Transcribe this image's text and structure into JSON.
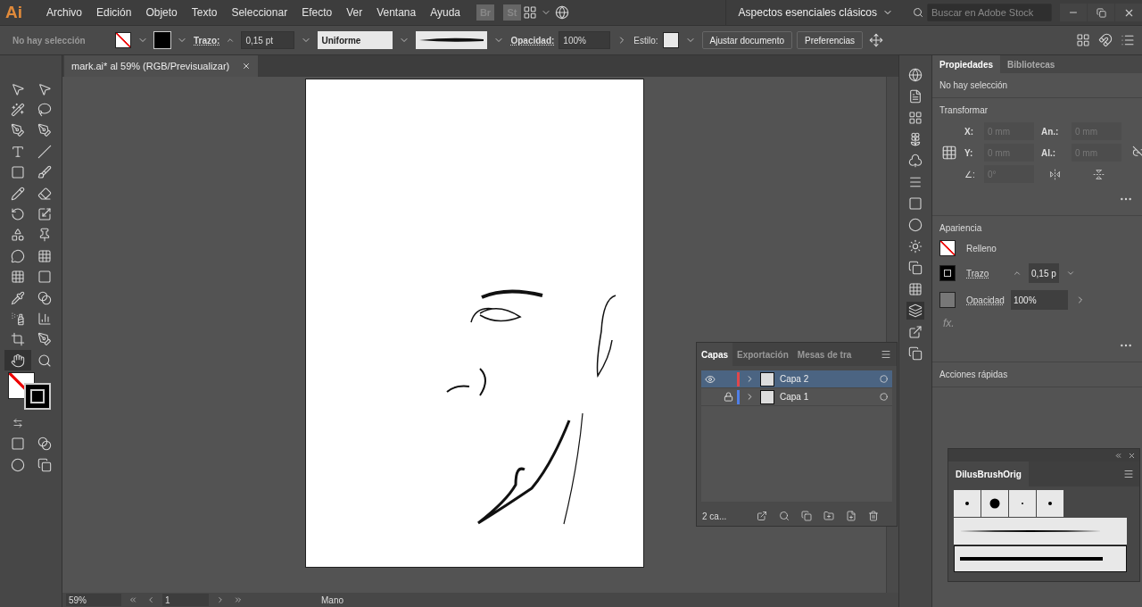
{
  "menu_bar": {
    "logo": "Ai",
    "menus": [
      "Archivo",
      "Edición",
      "Objeto",
      "Texto",
      "Seleccionar",
      "Efecto",
      "Ver",
      "Ventana",
      "Ayuda"
    ],
    "bridge": "Br",
    "stock": "St",
    "workspace": "Aspectos esenciales clásicos",
    "search": {
      "placeholder": "Buscar en Adobe Stock"
    }
  },
  "control_bar": {
    "selection": "No hay selección",
    "stroke_label": "Trazo:",
    "stroke_value": "0,15 pt",
    "profile": "Uniforme",
    "opacity_label": "Opacidad:",
    "opacity_value": "100%",
    "style_label": "Estilo:",
    "buttons": [
      "Ajustar documento",
      "Preferencias"
    ]
  },
  "document": {
    "tab": "mark.ai* al 59% (RGB/Previsualizar)",
    "zoom": "59%",
    "artboard": "1",
    "status": "Mano"
  },
  "layers_panel": {
    "tabs": [
      {
        "label": "Capas",
        "selected": true
      },
      {
        "label": "Exportación",
        "selected": false
      },
      {
        "label": "Mesas de tra",
        "selected": false
      }
    ],
    "layers": [
      {
        "name": "Capa 2",
        "visible": true,
        "locked": false,
        "selected": true,
        "color": "#e0474c"
      },
      {
        "name": "Capa 1",
        "visible": false,
        "locked": true,
        "selected": false,
        "color": "#4f7fe8"
      }
    ],
    "count": "2 ca..."
  },
  "properties_panel": {
    "tabs": [
      {
        "label": "Propiedades",
        "selected": true
      },
      {
        "label": "Bibliotecas",
        "selected": false
      }
    ],
    "selection": "No hay selección",
    "transform": {
      "title": "Transformar",
      "x_label": "X:",
      "x": "0 mm",
      "y_label": "Y:",
      "y": "0 mm",
      "w_label": "An.:",
      "w": "0 mm",
      "h_label": "Al.:",
      "h": "0 mm",
      "angle_label": "∠:",
      "angle": "0°"
    },
    "appearance": {
      "title": "Apariencia",
      "fill": "Relleno",
      "stroke": "Trazo",
      "stroke_value": "0,15 p",
      "opacity": "Opacidad",
      "opacity_value": "100%",
      "fx": "fx."
    },
    "quick_actions": "Acciones rápidas"
  },
  "brushes_panel": {
    "tab": "DilusBrushOrig"
  }
}
